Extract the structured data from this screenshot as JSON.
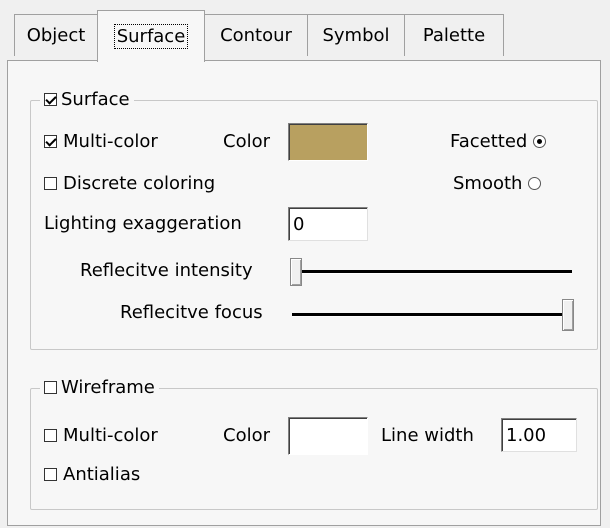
{
  "tabs": [
    {
      "label": "Object"
    },
    {
      "label": "Surface"
    },
    {
      "label": "Contour"
    },
    {
      "label": "Symbol"
    },
    {
      "label": "Palette"
    }
  ],
  "active_tab": "Surface",
  "surface_group": {
    "legend": "Surface",
    "enabled": true,
    "multi_color": {
      "label": "Multi-color",
      "checked": true
    },
    "color_label": "Color",
    "color_value": "#b8a060",
    "discrete_coloring": {
      "label": "Discrete coloring",
      "checked": false
    },
    "facetted": {
      "label": "Facetted",
      "selected": true
    },
    "smooth": {
      "label": "Smooth",
      "selected": false
    },
    "lighting_exaggeration": {
      "label": "Lighting exaggeration",
      "value": "0"
    },
    "reflective_intensity": {
      "label": "Reflecitve intensity",
      "level": 0.0
    },
    "reflective_focus": {
      "label": "Reflecitve focus",
      "level": 1.0
    }
  },
  "wireframe_group": {
    "legend": "Wireframe",
    "enabled": false,
    "multi_color": {
      "label": "Multi-color",
      "checked": false
    },
    "color_label": "Color",
    "color_value": "#ffffff",
    "line_width": {
      "label": "Line width",
      "value": "1.00"
    },
    "antialias": {
      "label": "Antialias",
      "checked": false
    }
  }
}
